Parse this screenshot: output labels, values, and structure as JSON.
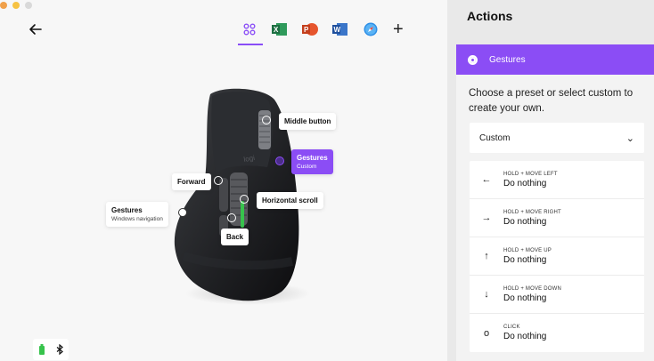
{
  "toolbar": {
    "apps": [
      {
        "name": "all-apps-icon"
      },
      {
        "name": "excel-icon"
      },
      {
        "name": "powerpoint-icon"
      },
      {
        "name": "word-icon"
      },
      {
        "name": "safari-icon"
      }
    ],
    "plus_label": "+"
  },
  "callouts": {
    "middle": "Middle button",
    "gestures": "Gestures",
    "gestures_sub": "Custom",
    "forward": "Forward",
    "horizontal": "Horizontal scroll",
    "gestures_win": "Gestures",
    "gestures_win_sub": "Windows navigation",
    "back": "Back"
  },
  "mouse_logo": "logi",
  "panel": {
    "title": "Actions",
    "gestures_label": "Gestures",
    "description": "Choose a preset or select custom to create your own.",
    "preset": "Custom",
    "chevron": "⌄",
    "actions": [
      {
        "icon": "←",
        "label": "HOLD + MOVE LEFT",
        "value": "Do nothing"
      },
      {
        "icon": "→",
        "label": "HOLD + MOVE RIGHT",
        "value": "Do nothing"
      },
      {
        "icon": "↑",
        "label": "HOLD + MOVE UP",
        "value": "Do nothing"
      },
      {
        "icon": "↓",
        "label": "HOLD + MOVE DOWN",
        "value": "Do nothing"
      },
      {
        "icon": "o",
        "label": "CLICK",
        "value": "Do nothing"
      }
    ]
  }
}
